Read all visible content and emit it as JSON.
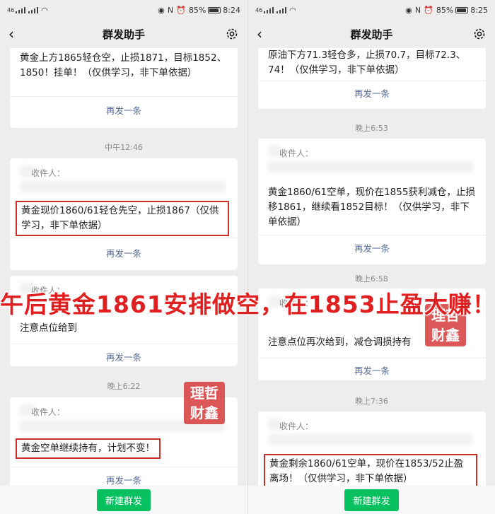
{
  "left": {
    "status": {
      "net": "46",
      "battery": "85%",
      "time": "8:24"
    },
    "nav": {
      "title": "群发助手"
    },
    "cards": [
      {
        "message": "黄金上方1865轻仓空，止损1871，目标1852、1850！挂单！（仅供学习，非下单依据）",
        "resend": "再发一条"
      },
      {
        "time": "中午12:46",
        "recipients": "收件人：",
        "message": "黄金现价1860/61轻仓先空，止损1867（仅供学习，非下单依据）",
        "resend": "再发一条"
      },
      {
        "recipients": "收件人：",
        "message": "注意点位给到",
        "resend": "再发一条"
      },
      {
        "time": "晚上6:22",
        "recipients": "收件人：",
        "message": "黄金空单继续持有，计划不变！",
        "resend": "再发一条"
      }
    ],
    "new_button": "新建群发"
  },
  "right": {
    "status": {
      "net": "46",
      "battery": "85%",
      "time": "8:25"
    },
    "nav": {
      "title": "群发助手"
    },
    "cards": [
      {
        "message": "原油下方71.3轻仓多，止损70.7，目标72.3、74！（仅供学习，非下单依据）",
        "resend": "再发一条"
      },
      {
        "time": "晚上6:53",
        "recipients": "收件人：",
        "message": "黄金1860/61空单，现价在1855获利减仓，止损移1861，继续看1852目标！（仅供学习，非下单依据）",
        "resend": "再发一条"
      },
      {
        "time": "晚上6:58",
        "recipients": "收件人：",
        "message": "注意点位再次给到，减仓调损持有",
        "resend": "再发一条"
      },
      {
        "time": "晚上7:36",
        "recipients": "收件人：",
        "message": "黄金剩余1860/61空单，现价在1853/52止盈离场！（仅供学习，非下单依据）"
      }
    ],
    "new_button": "新建群发"
  },
  "banner": "午后黄金1861安排做空，在1853止盈大赚！",
  "watermark": {
    "line1": "理哲",
    "line2": "财鑫"
  },
  "colors": {
    "accent": "#07c160",
    "link": "#576b95",
    "highlight": "#c9302c",
    "banner": "#e02020"
  }
}
